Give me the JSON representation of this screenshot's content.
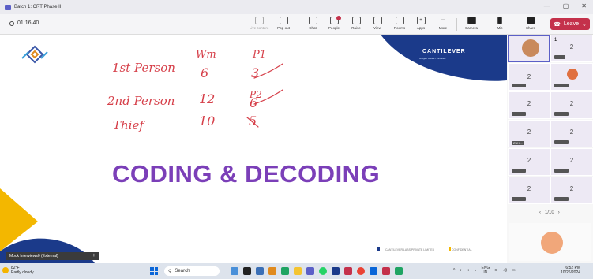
{
  "window": {
    "title": "Batch 1: CRT Phase II"
  },
  "toolbar": {
    "timer": "01:16:40",
    "buttons": [
      {
        "label": "Live content",
        "icon": "live-content-icon"
      },
      {
        "label": "Pop-out",
        "icon": "pop-out-icon"
      },
      {
        "label": "Chat",
        "icon": "chat-icon"
      },
      {
        "label": "People",
        "icon": "people-icon"
      },
      {
        "label": "Raise",
        "icon": "raise-hand-icon"
      },
      {
        "label": "View",
        "icon": "view-icon"
      },
      {
        "label": "Rooms",
        "icon": "rooms-icon"
      },
      {
        "label": "Apps",
        "icon": "apps-icon"
      },
      {
        "label": "More",
        "icon": "more-icon"
      },
      {
        "label": "Camera",
        "icon": "camera-icon"
      },
      {
        "label": "Mic",
        "icon": "mic-icon"
      },
      {
        "label": "Share",
        "icon": "share-icon"
      }
    ],
    "leave_label": "Leave"
  },
  "slide": {
    "title": "CODING & DECODING",
    "brand": "CANTILEVER",
    "brand_tagline": "bridge • create • innovate",
    "footer_left": "CANTILEVER LABS PRIVATE LIMITED",
    "footer_right": "CONFIDENTIAL",
    "handwriting": {
      "row1": [
        "1st Person",
        "6",
        "3"
      ],
      "row2": [
        "2nd Person",
        "12",
        "6"
      ],
      "row3": [
        "Thief",
        "10",
        "5"
      ],
      "col_head1": "Wm",
      "col_head2": "P1",
      "col_head2b": "P2"
    },
    "colors": {
      "title": "#7b3fb8",
      "ink": "#d6404a",
      "brand_band": "#1b3a8a",
      "accent_orange": "#f3b700"
    }
  },
  "share_pill": {
    "label": "Mock Interviews0 (External)",
    "plus": "+"
  },
  "gallery": {
    "tile_number": "2",
    "tile_first_label": "1",
    "small_label": "ZUH...",
    "pager": "1/10"
  },
  "taskbar": {
    "weather_temp": "82°F",
    "weather_desc": "Partly cloudy",
    "search_label": "Search",
    "lang": "ENG",
    "lang_region": "IN",
    "time": "6:52 PM",
    "date": "10/26/2024"
  }
}
